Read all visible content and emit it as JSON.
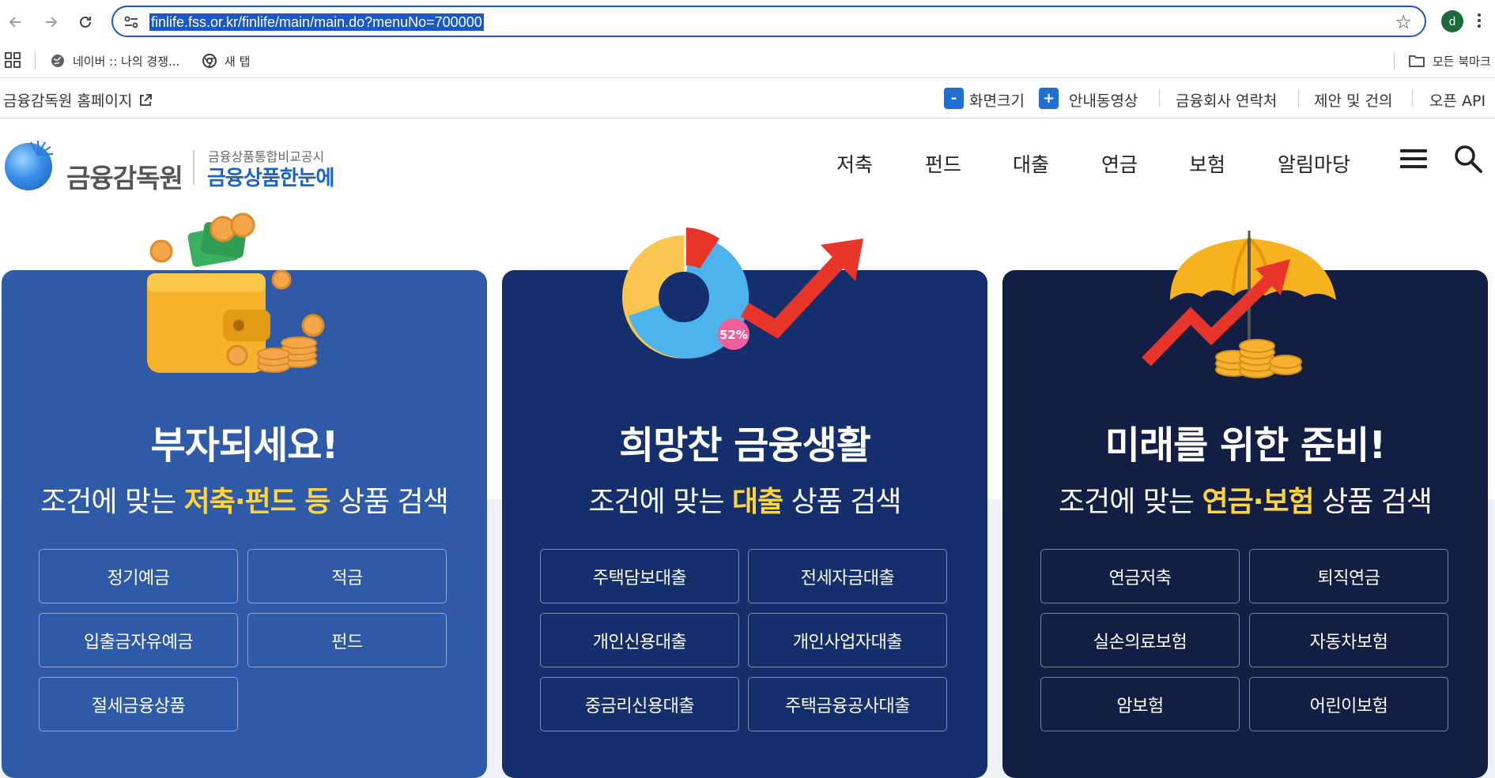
{
  "browser": {
    "url": "finlife.fss.or.kr/finlife/main/main.do?menuNo=700000",
    "profile_initial": "d",
    "bookmarks": [
      {
        "label": "네이버 :: 나의 경쟁..."
      },
      {
        "label": "새 탭"
      }
    ],
    "all_bookmarks_label": "모든 북마크"
  },
  "utility": {
    "home_link": "금융감독원 홈페이지",
    "zoom_minus": "-",
    "zoom_label": "화면크기",
    "zoom_plus": "+",
    "links": [
      "안내동영상",
      "금융회사 연락처",
      "제안 및 건의",
      "오픈 API"
    ]
  },
  "header": {
    "logo_main": "금융감독원",
    "logo_sub": "금융상품통합비교공시",
    "logo_title": "금융상품한눈에",
    "nav": [
      "저축",
      "펀드",
      "대출",
      "연금",
      "보험",
      "알림마당"
    ]
  },
  "cards": [
    {
      "headline": "부자되세요!",
      "sub_prefix": "조건에 맞는 ",
      "sub_highlight": "저축·펀드 등",
      "sub_suffix": " 상품 검색",
      "buttons": [
        "정기예금",
        "적금",
        "입출금자유예금",
        "펀드",
        "절세금융상품"
      ]
    },
    {
      "headline": "희망찬 금융생활",
      "sub_prefix": "조건에 맞는 ",
      "sub_highlight": "대출",
      "sub_suffix": " 상품 검색",
      "buttons": [
        "주택담보대출",
        "전세자금대출",
        "개인신용대출",
        "개인사업자대출",
        "중금리신용대출",
        "주택금융공사대출"
      ]
    },
    {
      "headline": "미래를 위한 준비!",
      "sub_prefix": "조건에 맞는 ",
      "sub_highlight": "연금·보험",
      "sub_suffix": " 상품 검색",
      "buttons": [
        "연금저축",
        "퇴직연금",
        "실손의료보험",
        "자동차보험",
        "암보험",
        "어린이보험"
      ]
    }
  ],
  "illustrations": {
    "chart_badge": "52%"
  },
  "colors": {
    "card1": "#2e5aa8",
    "card2": "#142f6b",
    "card3": "#131e45",
    "highlight": "#ffd43b",
    "brand_blue": "#1a64c8"
  }
}
